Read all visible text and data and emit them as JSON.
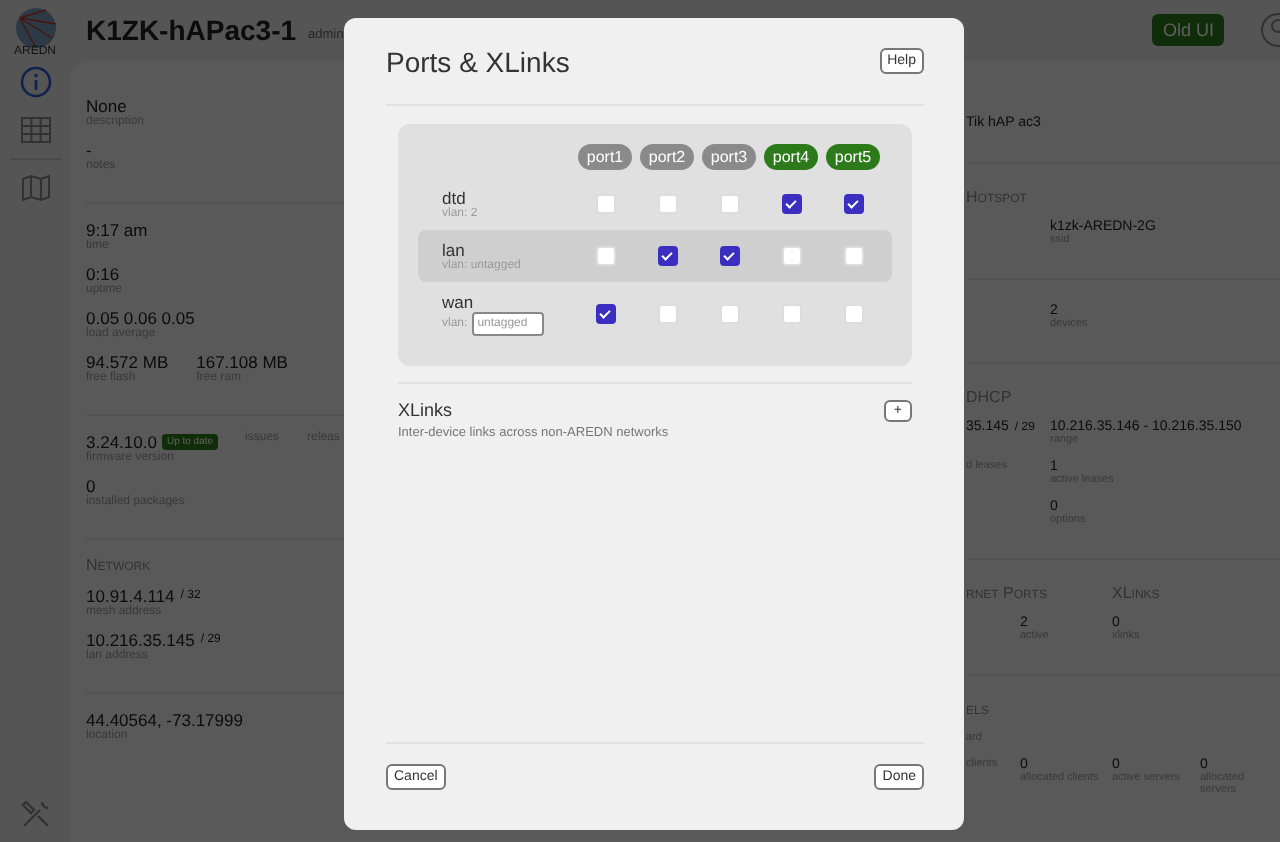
{
  "sidebar": {
    "logo_text": "AREDN",
    "items": [
      {
        "kind": "info",
        "selected": true
      },
      {
        "kind": "grid",
        "selected": false
      },
      {
        "kind": "map",
        "selected": false
      }
    ]
  },
  "header": {
    "title": "K1ZK-hAPac3-1",
    "user": "admin",
    "old_ui_button": "Old UI"
  },
  "left_column": [
    {
      "rows": [
        [
          {
            "value": "None",
            "label": "description"
          }
        ],
        [
          {
            "value": "-",
            "label": "notes"
          }
        ]
      ]
    },
    {
      "rows": [
        [
          {
            "value": "9:17 am",
            "label": "time"
          }
        ],
        [
          {
            "value": "0:16",
            "label": "uptime"
          }
        ],
        [
          {
            "value": "0.05  0.06  0.05",
            "label": "load average"
          }
        ],
        [
          {
            "value": "94.572 MB",
            "label": "free flash"
          },
          {
            "value": "167.108 MB",
            "label": "free ram"
          }
        ]
      ]
    },
    {
      "rows": [
        [
          {
            "value": "3.24.10.0",
            "badge": "Up to date",
            "label": "firmware version"
          },
          {
            "label": "issues"
          },
          {
            "label": "releas"
          }
        ],
        [
          {
            "value": "0",
            "label": "installed packages"
          }
        ]
      ]
    },
    {
      "headings": [
        "Network"
      ],
      "rows": [
        [
          {
            "value": "10.91.4.114",
            "unit": "/ 32",
            "label": "mesh address"
          }
        ],
        [
          {
            "value": "10.216.35.145",
            "unit": "/ 29",
            "label": "lan address"
          }
        ]
      ]
    },
    {
      "rows": [
        [
          {
            "value": "44.40564, -73.17999",
            "label": "location"
          }
        ]
      ]
    }
  ],
  "right_column": [
    {
      "kind": "pair",
      "rows": [
        [
          {
            "value": "Tik hAP ac3"
          }
        ]
      ]
    },
    {
      "kind": "pair",
      "headings": [
        "Hotspot"
      ],
      "rows": [
        [
          {},
          {
            "value": "k1zk-AREDN-2G",
            "label": "ssid"
          }
        ]
      ]
    },
    {
      "kind": "pair",
      "rows": [
        [
          {},
          {
            "value": "2",
            "label": "devices"
          }
        ]
      ]
    },
    {
      "kind": "pair",
      "headings": [
        "DHCP"
      ],
      "rows": [
        [
          {
            "value": "35.145",
            "unit": "/ 29"
          },
          {
            "value": "10.216.35.146 - 10.216.35.150",
            "label": "range"
          }
        ],
        [
          {
            "label": "d leases"
          },
          {
            "value": "1",
            "label": "active leases"
          }
        ],
        [
          {},
          {
            "value": "0",
            "label": "options"
          }
        ]
      ]
    },
    {
      "kind": "quad",
      "headings": [
        "rnet Ports",
        "XLinks"
      ],
      "rows": [
        [
          {},
          {
            "value": "2",
            "label": "active"
          },
          {
            "value": "0",
            "label": "xlinks"
          }
        ]
      ]
    },
    {
      "kind": "quad",
      "headings": [
        "els"
      ],
      "rows": [
        [
          {
            "label": "ard"
          }
        ],
        [
          {
            "label": "clients"
          },
          {
            "value": "0",
            "label": "allocated clients"
          },
          {
            "value": "0",
            "label": "active servers"
          },
          {
            "value": "0",
            "label": "allocated servers"
          }
        ]
      ]
    }
  ],
  "dialog": {
    "title": "Ports & XLinks",
    "help_button": "Help",
    "ports": [
      {
        "label": "port1",
        "active": false
      },
      {
        "label": "port2",
        "active": false
      },
      {
        "label": "port3",
        "active": false
      },
      {
        "label": "port4",
        "active": true
      },
      {
        "label": "port5",
        "active": true
      }
    ],
    "networks": [
      {
        "name": "dtd",
        "vlan_label": "vlan: 2",
        "selected": false,
        "members": [
          {
            "checked": false
          },
          {
            "checked": false
          },
          {
            "checked": false
          },
          {
            "checked": true
          },
          {
            "checked": true
          }
        ]
      },
      {
        "name": "lan",
        "vlan_label": "vlan: untagged",
        "selected": true,
        "members": [
          {
            "checked": false
          },
          {
            "checked": true
          },
          {
            "checked": true
          },
          {
            "checked": false
          },
          {
            "checked": false
          }
        ]
      },
      {
        "name": "wan",
        "vlan_label": "vlan:",
        "vlan_placeholder": "untagged",
        "selected": false,
        "members": [
          {
            "checked": true
          },
          {
            "checked": false
          },
          {
            "checked": false
          },
          {
            "checked": false
          },
          {
            "checked": false
          }
        ]
      }
    ],
    "xlinks": {
      "title": "XLinks",
      "description": "Inter-device links across non-AREDN networks",
      "add_button": "+"
    },
    "cancel_button": "Cancel",
    "done_button": "Done"
  }
}
